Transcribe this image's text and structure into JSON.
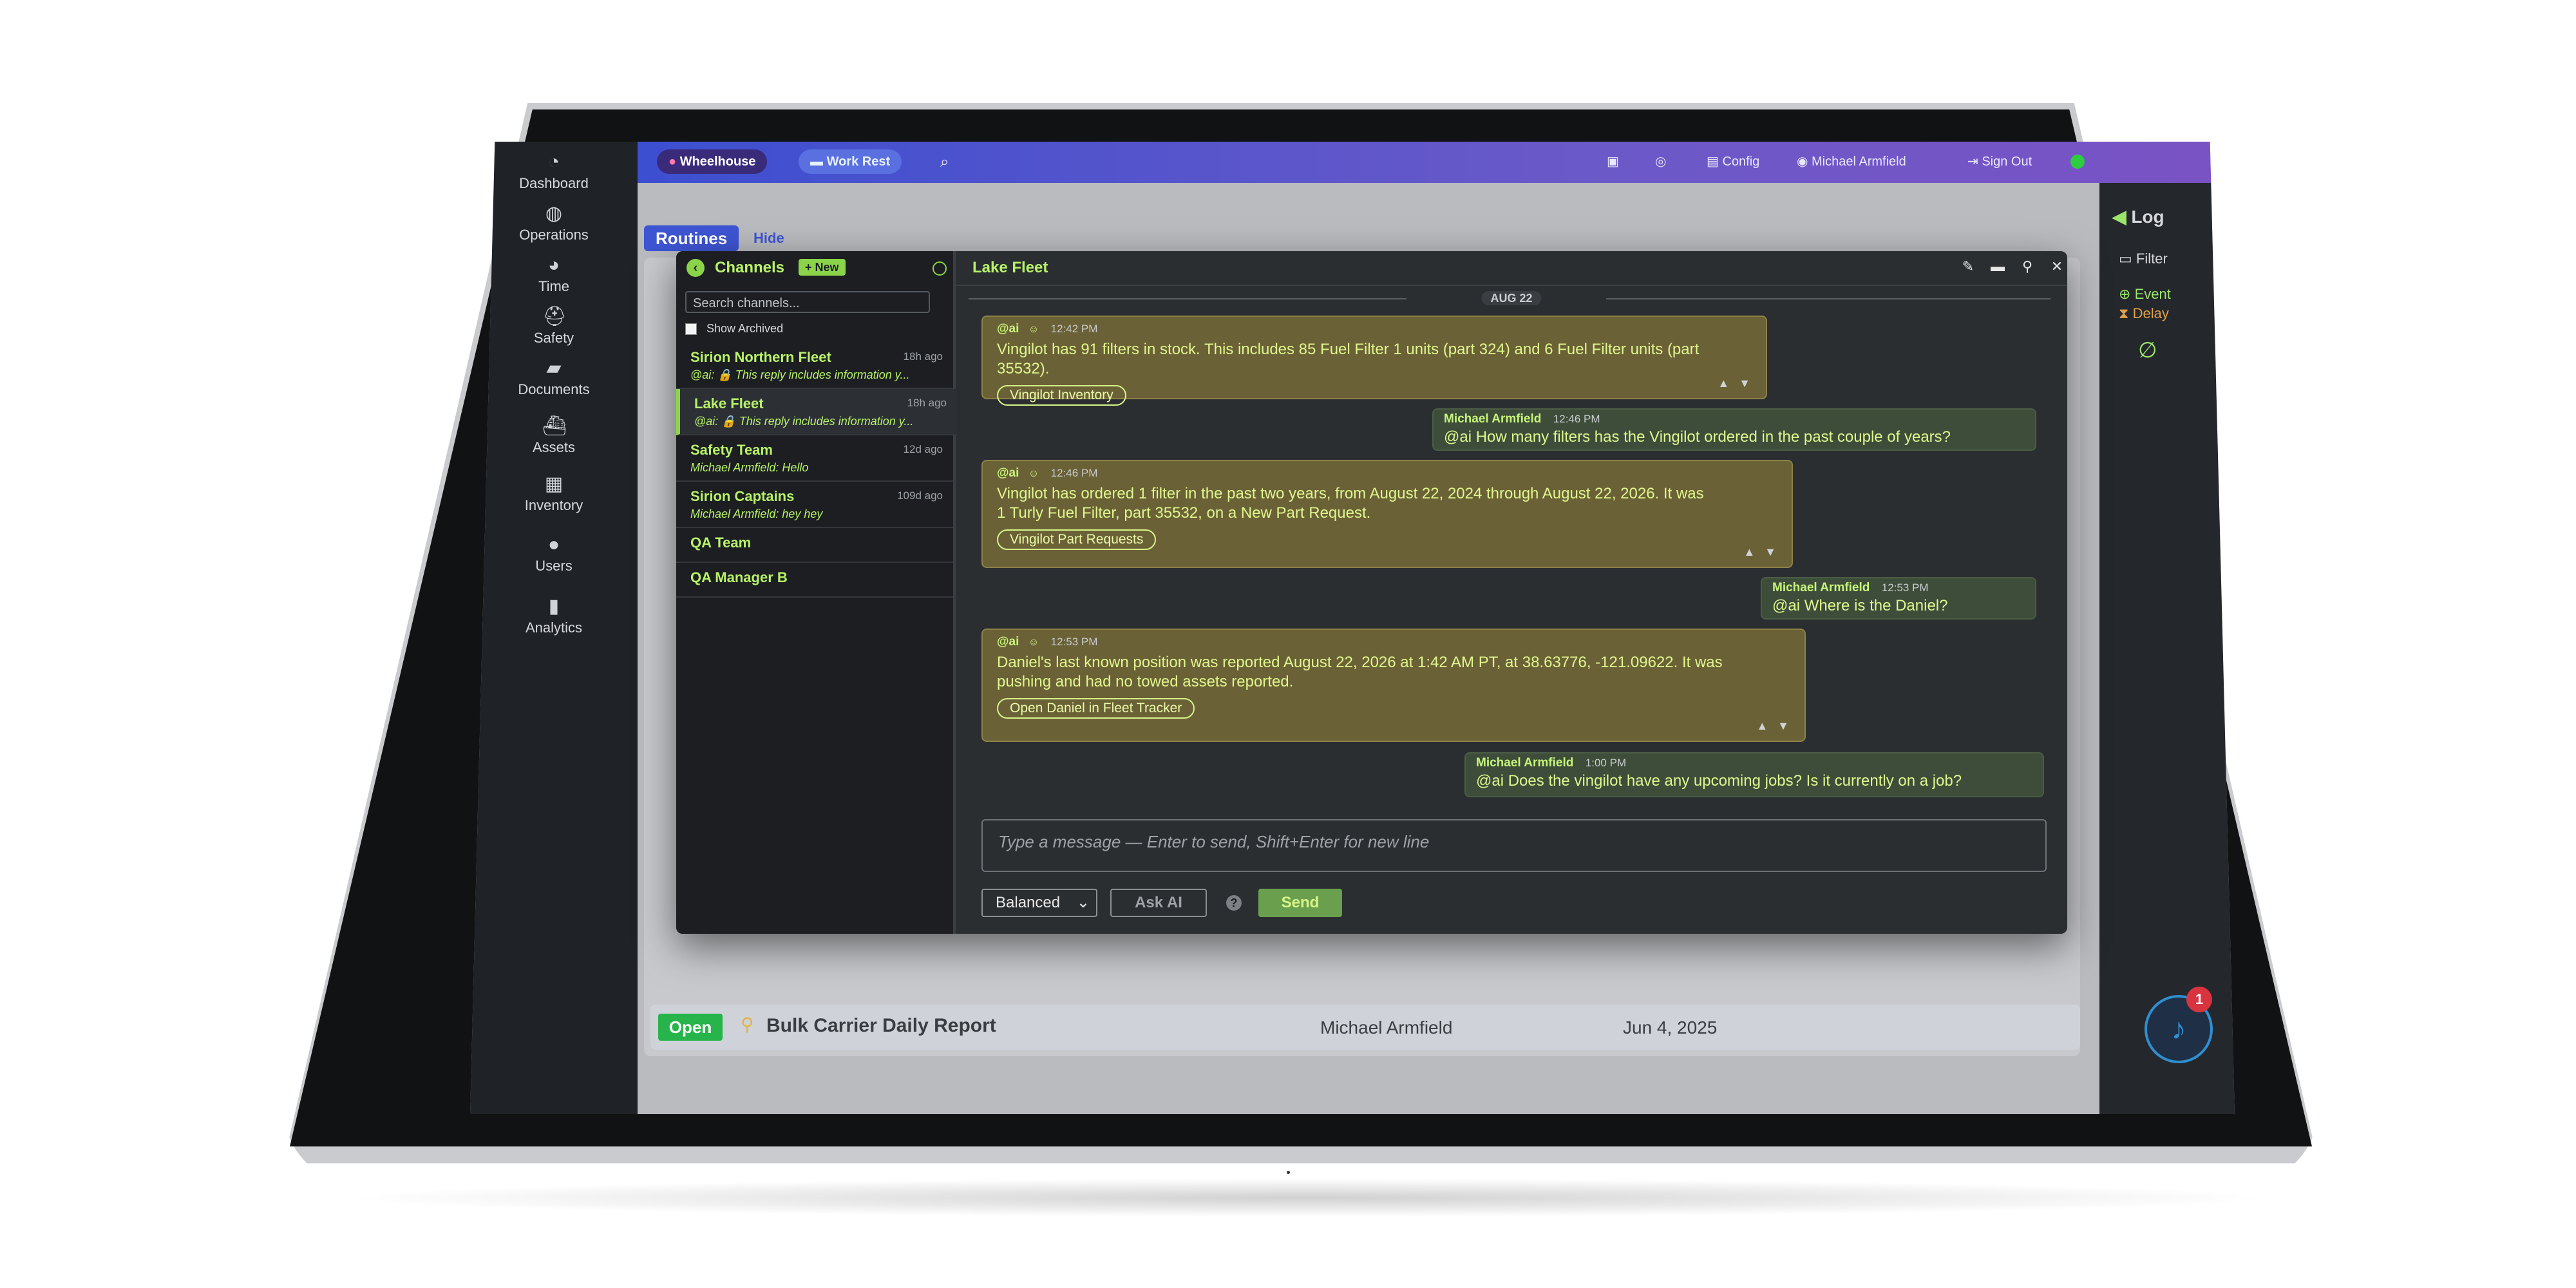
{
  "sidebar": {
    "items": [
      {
        "label": "Dashboard",
        "icon": "dashboard-icon"
      },
      {
        "label": "Operations",
        "icon": "operations-icon"
      },
      {
        "label": "Time",
        "icon": "time-icon"
      },
      {
        "label": "Safety",
        "icon": "safety-icon"
      },
      {
        "label": "Documents",
        "icon": "documents-icon"
      },
      {
        "label": "Assets",
        "icon": "assets-icon"
      },
      {
        "label": "Inventory",
        "icon": "inventory-icon"
      },
      {
        "label": "Users",
        "icon": "users-icon"
      },
      {
        "label": "Analytics",
        "icon": "analytics-icon"
      }
    ]
  },
  "topbar": {
    "wheelhouse": "Wheelhouse",
    "work_rest": "Work Rest",
    "config": "Config",
    "user": "Michael Armfield",
    "sign_out": "Sign Out"
  },
  "page": {
    "routines": "Routines",
    "hide": "Hide",
    "row_status": "Open",
    "row_title": "Bulk Carrier Daily Report",
    "row_user": "Michael Armfield",
    "row_date": "Jun 4, 2025"
  },
  "right_panel": {
    "log": "Log",
    "filter": "Filter",
    "event": "Event",
    "delay": "Delay"
  },
  "channels": {
    "title": "Channels",
    "new_label": "+ New",
    "search_placeholder": "Search channels...",
    "show_archived": "Show Archived",
    "items": [
      {
        "name": "Sirion Northern Fleet",
        "time": "18h ago",
        "preview": "@ai: 🔒 This reply includes information y..."
      },
      {
        "name": "Lake Fleet",
        "time": "18h ago",
        "preview": "@ai: 🔒 This reply includes information y..."
      },
      {
        "name": "Safety Team",
        "time": "12d ago",
        "preview": "Michael Armfield: Hello"
      },
      {
        "name": "Sirion Captains",
        "time": "109d ago",
        "preview": "Michael Armfield: hey hey"
      },
      {
        "name": "QA Team",
        "time": "",
        "preview": ""
      },
      {
        "name": "QA Manager B",
        "time": "",
        "preview": ""
      }
    ]
  },
  "conversation": {
    "title": "Lake Fleet",
    "date": "AUG 22",
    "messages": [
      {
        "who": "@ai",
        "time": "12:42 PM",
        "text": "Vingilot has 91 filters in stock. This includes 85 Fuel Filter 1 units (part 324) and 6 Fuel Filter units (part 35532).",
        "link": "Vingilot Inventory"
      },
      {
        "who": "Michael Armfield",
        "time": "12:46 PM",
        "text": "@ai How many filters has the Vingilot ordered in the past couple of years?"
      },
      {
        "who": "@ai",
        "time": "12:46 PM",
        "text": "Vingilot has ordered 1 filter in the past two years, from August 22, 2024 through August 22, 2026. It was 1 Turly Fuel Filter, part 35532, on a New Part Request.",
        "link": "Vingilot Part Requests"
      },
      {
        "who": "Michael Armfield",
        "time": "12:53 PM",
        "text": "@ai Where is the Daniel?"
      },
      {
        "who": "@ai",
        "time": "12:53 PM",
        "text": "Daniel's last known position was reported August 22, 2026 at 1:42 AM PT, at 38.63776, -121.09622. It was pushing and had no towed assets reported.",
        "link": "Open Daniel in Fleet Tracker"
      },
      {
        "who": "Michael Armfield",
        "time": "1:00 PM",
        "text": "@ai Does the vingilot have any upcoming jobs? Is it currently on a job?"
      }
    ]
  },
  "composer": {
    "placeholder": "Type a message — Enter to send, Shift+Enter for new line",
    "mode": "Balanced",
    "ask_ai": "Ask AI",
    "help": "?",
    "send": "Send"
  },
  "notifications": {
    "count": "1"
  },
  "colors": {
    "accent_green": "#b8f26a",
    "brand_blue": "#3e55d3",
    "ai_bubble": "#6b6136",
    "user_bubble": "#3e4d3a"
  }
}
